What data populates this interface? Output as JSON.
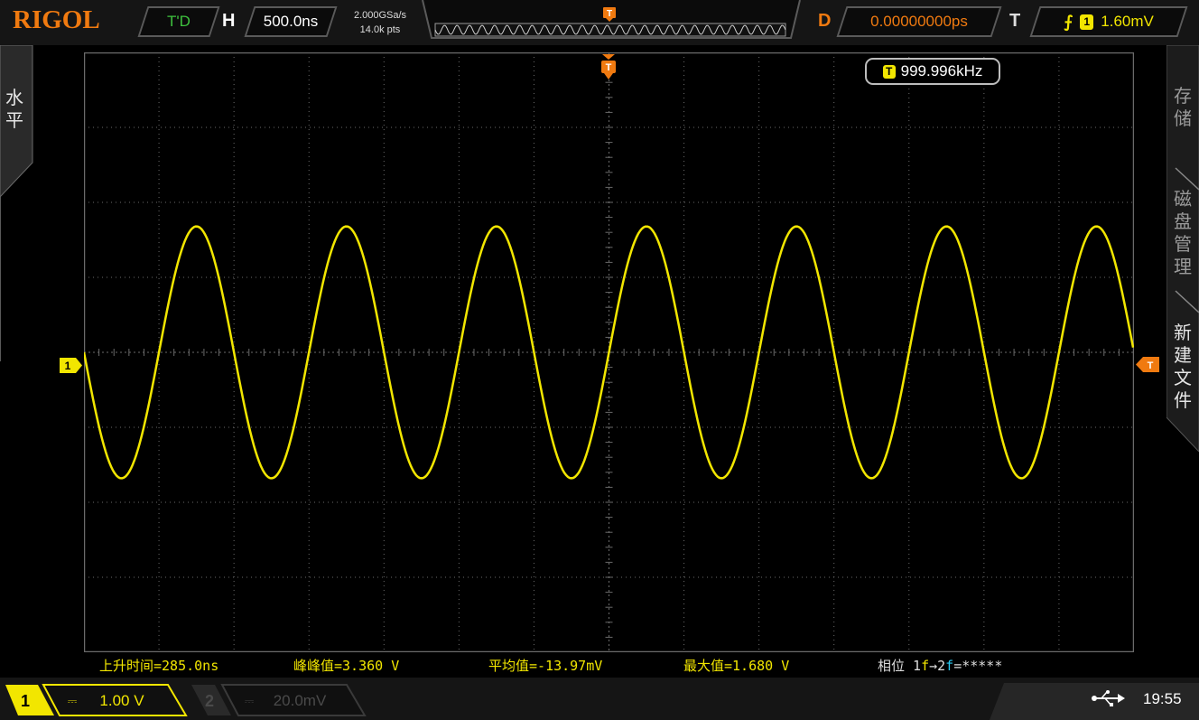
{
  "brand": {
    "logo": "RIGOL"
  },
  "top": {
    "trigger_status": "T'D",
    "horizontal_label": "H",
    "timebase": "500.0ns",
    "sample_rate": "2.000GSa/s",
    "memory_depth": "14.0k pts",
    "delay_label": "D",
    "delay": "0.00000000ps",
    "trigger_label": "T",
    "trigger_source": "1",
    "trigger_level": "1.60mV",
    "trigger_marker": "T"
  },
  "left_menu": {
    "label": "水平"
  },
  "right_menu": {
    "items": [
      {
        "label": "存储",
        "active": false
      },
      {
        "label": "磁盘管理",
        "active": false
      },
      {
        "label": "新建文件",
        "active": true
      }
    ]
  },
  "display": {
    "frequency": "999.996kHz",
    "frequency_source": "T",
    "ch1_marker": "1",
    "trigger_level_marker": "T",
    "grid": {
      "h_divisions": 14,
      "v_divisions": 8
    },
    "waveform": {
      "channel": 1,
      "color": "#f2e600",
      "type": "sine",
      "frequency_hz": 999996,
      "cycles_visible": 7,
      "vpp_divisions": 3.36,
      "phase_at_start": "falling-zero-crossing"
    }
  },
  "measurements": {
    "rise_time": "上升时间=285.0ns",
    "peak_to_peak": "峰峰值=3.360 V",
    "mean": "平均值=-13.97mV",
    "max": "最大值=1.680 V",
    "phase_prefix": "相位 1",
    "phase_f1": "f",
    "phase_arrow": "→2",
    "phase_f2": "f",
    "phase_value": "=*****"
  },
  "bottom": {
    "ch1_number": "1",
    "ch1_coupling": "⎓",
    "ch1_scale": "1.00 V",
    "ch2_number": "2",
    "ch2_coupling": "⎓",
    "ch2_scale": "20.0mV",
    "usb_icon": "usb-icon",
    "time": "19:55"
  },
  "colors": {
    "ch1": "#f2e600",
    "ch2": "#28c8f0",
    "accent": "#f07a10",
    "status_green": "#3ec23e",
    "grid": "#6a6a6a"
  }
}
